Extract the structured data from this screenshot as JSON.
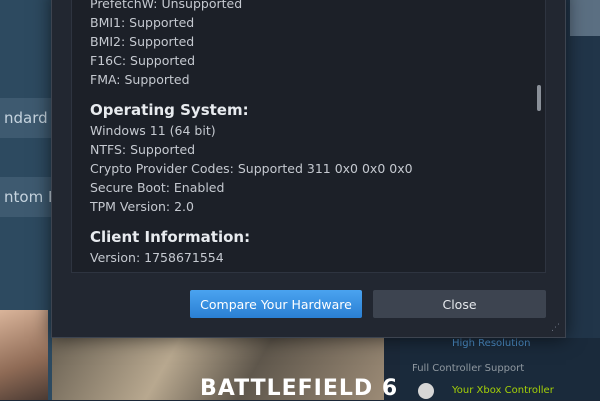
{
  "background": {
    "side_buttons": [
      "ndard E",
      "ntom E"
    ],
    "game_title": "BATTLEFIELD 6",
    "right_panel": {
      "line1": "High Resolution",
      "line2": "Full Controller Support",
      "line3": "Your Xbox Controller"
    }
  },
  "dialog": {
    "lines_top": [
      "PrefetchW: Unsupported",
      "BMI1: Supported",
      "BMI2: Supported",
      "F16C: Supported",
      "FMA: Supported"
    ],
    "os_section": {
      "title": "Operating System:",
      "lines": [
        "Windows 11 (64 bit)",
        "NTFS: Supported",
        "Crypto Provider Codes: Supported 311 0x0 0x0 0x0",
        "Secure Boot: Enabled",
        "TPM Version: 2.0"
      ]
    },
    "client_section": {
      "title": "Client Information:",
      "lines": [
        "Version: 1758671554"
      ]
    },
    "buttons": {
      "compare": "Compare Your Hardware",
      "close": "Close"
    }
  },
  "colors": {
    "primary_button": "#2a7fd4",
    "dialog_bg": "#222731",
    "text": "#c5c9d0"
  }
}
